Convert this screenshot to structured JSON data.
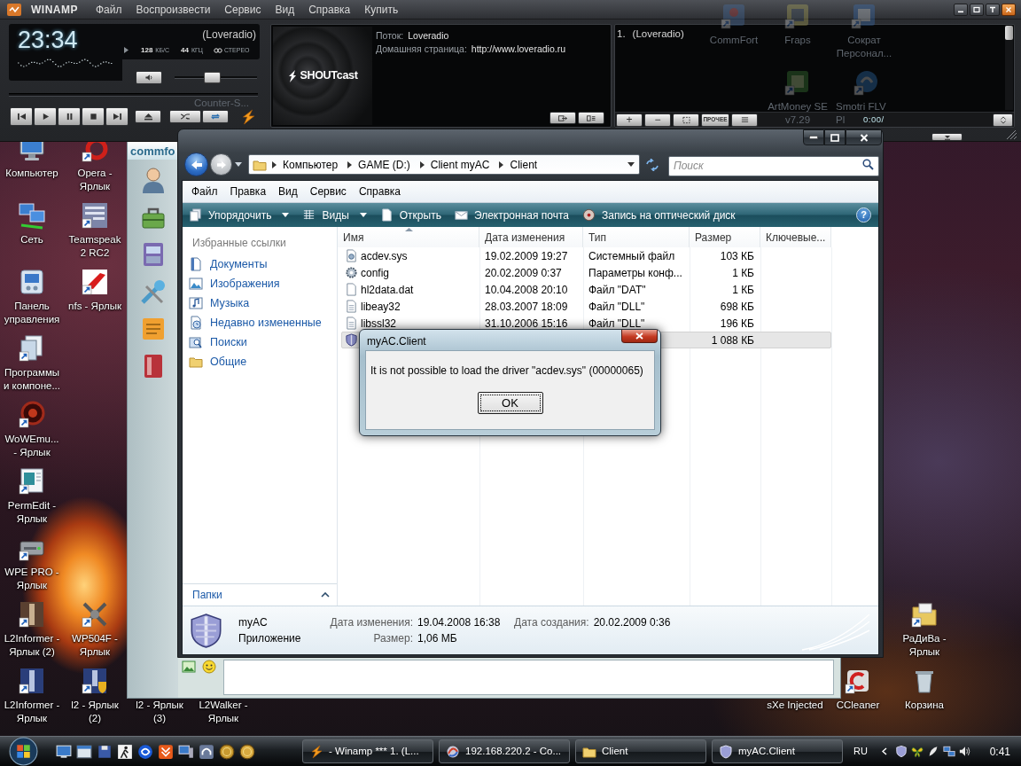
{
  "winamp": {
    "title": "WINAMP",
    "menu": [
      "Файл",
      "Воспроизвести",
      "Сервис",
      "Вид",
      "Справка",
      "Купить"
    ],
    "player": {
      "time": "23:34",
      "station": "(Loveradio)",
      "bitrate": "128",
      "bitrate_unit": "КБ/С",
      "samplerate": "44",
      "samplerate_unit": "КГЦ",
      "mode": "СТЕРЕО",
      "volume": {
        "level": 0.44
      }
    },
    "info": {
      "logo": "SHOUTcast",
      "fields": [
        {
          "label": "Поток:",
          "value": "Loveradio"
        },
        {
          "label": "Домашняя страница:",
          "value": "http://www.loveradio.ru"
        }
      ]
    },
    "playlist": {
      "items": [
        {
          "number": "1.",
          "title": "(Loveradio)"
        }
      ],
      "add": "+",
      "remove": "−",
      "misc": "ПРОЧЕЕ",
      "time": "0:00/"
    }
  },
  "desktop": {
    "faded_icons": [
      {
        "label": "CommFort",
        "kind": "icon",
        "shortcut": true
      },
      {
        "label": "Fraps",
        "kind": "icon",
        "shortcut": true
      },
      {
        "label": "Сократ\nПерсонал...",
        "kind": "icon",
        "shortcut": true
      },
      {
        "label": "Counter-S...",
        "kind": "label"
      },
      {
        "label": "ArtMoney SE\nv7.29",
        "kind": "icon",
        "shortcut": true
      },
      {
        "label": "Smotri FLV\nPl",
        "kind": "icon",
        "shortcut": true
      }
    ],
    "left_icons": [
      {
        "label": "Компьютер",
        "kind": "icon",
        "shortcut": false
      },
      {
        "label": "Opera -\nЯрлык",
        "kind": "icon",
        "shortcut": true
      },
      {
        "label": "Сеть",
        "kind": "icon",
        "shortcut": false
      },
      {
        "label": "Teamspeak\n2 RC2",
        "kind": "icon",
        "shortcut": true
      },
      {
        "label": "Панель\nуправления",
        "kind": "icon",
        "shortcut": false
      },
      {
        "label": "nfs - Ярлык",
        "kind": "icon",
        "shortcut": true
      },
      {
        "label": "Программы\nи компоне...",
        "kind": "icon",
        "shortcut": true
      },
      {
        "label": "WoWEmu...\n- Ярлык",
        "kind": "icon",
        "shortcut": true
      },
      {
        "label": "PermEdit -\nЯрлык",
        "kind": "icon",
        "shortcut": true
      },
      {
        "label": "WPE PRO -\nЯрлык",
        "kind": "icon",
        "shortcut": true
      },
      {
        "label": "L2Informer -\nЯрлык (2)",
        "kind": "icon",
        "shortcut": true
      },
      {
        "label": "WP504F -\nЯрлык",
        "kind": "icon",
        "shortcut": true
      },
      {
        "label": "L2Informer -\nЯрлык",
        "kind": "icon",
        "shortcut": true
      },
      {
        "label": "l2 - Ярлык\n(2)",
        "kind": "icon",
        "shortcut": true
      },
      {
        "label": "l2 - Ярлык\n(3)",
        "kind": "label"
      },
      {
        "label": "L2Walker -\nЯрлык",
        "kind": "label"
      }
    ],
    "right_icons": [
      {
        "label": "РаДиВа -\nЯрлык",
        "kind": "icon",
        "shortcut": true
      },
      {
        "label": "sXe Injected",
        "kind": "label"
      },
      {
        "label": "CCleaner",
        "kind": "icon",
        "shortcut": true
      },
      {
        "label": "Корзина",
        "kind": "icon",
        "shortcut": false
      }
    ]
  },
  "chat_window": {
    "logo": "commfo"
  },
  "explorer": {
    "breadcrumb": [
      "Компьютер",
      "GAME (D:)",
      "Client myAC",
      "Client"
    ],
    "search": {
      "placeholder": "Поиск"
    },
    "menu": [
      "Файл",
      "Правка",
      "Вид",
      "Сервис",
      "Справка"
    ],
    "toolbar": [
      {
        "label": "Упорядочить",
        "dropdown": true
      },
      {
        "label": "Виды",
        "dropdown": true
      },
      {
        "label": "Открыть",
        "dropdown": false
      },
      {
        "label": "Электронная почта",
        "dropdown": false
      },
      {
        "label": "Запись на оптический диск",
        "dropdown": false
      }
    ],
    "help": "?",
    "nav": {
      "heading": "Избранные ссылки",
      "links": [
        "Документы",
        "Изображения",
        "Музыка",
        "Недавно измененные",
        "Поиски",
        "Общие"
      ],
      "folders": {
        "label": "Папки",
        "expanded": false
      }
    },
    "columns": [
      "Имя",
      "Дата изменения",
      "Тип",
      "Размер",
      "Ключевые..."
    ],
    "rows": [
      {
        "name": "acdev.sys",
        "modified": "19.02.2009 19:27",
        "type": "Системный файл",
        "size": "103 КБ",
        "selected": false
      },
      {
        "name": "config",
        "modified": "20.02.2009 0:37",
        "type": "Параметры конф...",
        "size": "1 КБ",
        "selected": false
      },
      {
        "name": "hl2data.dat",
        "modified": "10.04.2008 20:10",
        "type": "Файл \"DAT\"",
        "size": "1 КБ",
        "selected": false
      },
      {
        "name": "libeay32",
        "modified": "28.03.2007 18:09",
        "type": "Файл \"DLL\"",
        "size": "698 КБ",
        "selected": false
      },
      {
        "name": "libssl32",
        "modified": "31.10.2006 15:16",
        "type": "Файл \"DLL\"",
        "size": "196 КБ",
        "selected": false
      },
      {
        "size": "1 088 КБ",
        "selected": true
      }
    ],
    "details": {
      "name": "myAC",
      "type": "Приложение",
      "fields": [
        {
          "label": "Дата изменения:",
          "value": "19.04.2008 16:38"
        },
        {
          "label": "Размер:",
          "value": "1,06 МБ"
        },
        {
          "label": "Дата создания:",
          "value": "20.02.2009 0:36"
        }
      ]
    }
  },
  "dialog": {
    "title": "myAC.Client",
    "message": "It is not possible to load the driver \"acdev.sys\" (00000065)",
    "button": "OK"
  },
  "taskbar": {
    "tasks": [
      {
        "label": "- Winamp *** 1. (L..."
      },
      {
        "label": "192.168.220.2 - Co..."
      },
      {
        "label": "Client"
      },
      {
        "label": "myAC.Client"
      }
    ],
    "language": "RU",
    "clock": "0:41"
  }
}
